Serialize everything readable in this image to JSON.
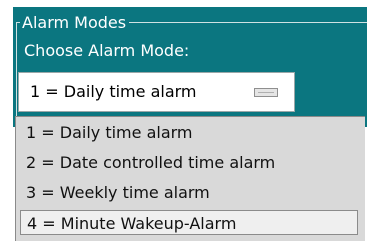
{
  "group": {
    "title": "Alarm Modes",
    "choose_label": "Choose Alarm Mode:"
  },
  "combobox": {
    "selected_value": "1 = Daily time alarm"
  },
  "dropdown": {
    "options": [
      {
        "label": "1 = Daily time alarm"
      },
      {
        "label": "2 = Date controlled time alarm"
      },
      {
        "label": "3 = Weekly time alarm"
      },
      {
        "label": "4 = Minute Wakeup-Alarm"
      }
    ],
    "highlighted_index": 3
  },
  "colors": {
    "panel_background": "#0b7680",
    "dropdown_background": "#d9d9d9",
    "highlight_background": "#efefef"
  }
}
